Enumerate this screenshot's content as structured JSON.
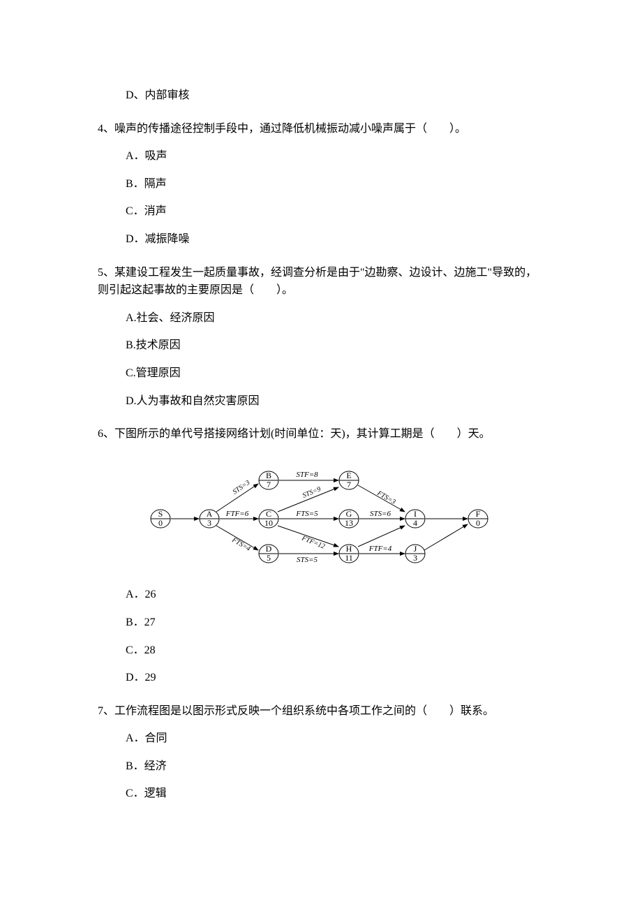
{
  "q3": {
    "options": {
      "d": "D、内部审核"
    }
  },
  "q4": {
    "text": "4、噪声的传播途径控制手段中，通过降低机械振动减小噪声属于（　　）。",
    "options": {
      "a": "A．吸声",
      "b": "B．隔声",
      "c": "C．消声",
      "d": "D．减振降噪"
    }
  },
  "q5": {
    "text_line1": "5、某建设工程发生一起质量事故，经调查分析是由于\"边勘察、边设计、边施工\"导致的，",
    "text_line2": "则引起这起事故的主要原因是（　　）。",
    "options": {
      "a": "A.社会、经济原因",
      "b": "B.技术原因",
      "c": "C.管理原因",
      "d": "D.人为事故和自然灾害原因"
    }
  },
  "q6": {
    "text": "6、下图所示的单代号搭接网络计划(时间单位：天)，其计算工期是（　　）天。",
    "options": {
      "a": "A．26",
      "b": "B．27",
      "c": "C．28",
      "d": "D．29"
    }
  },
  "q7": {
    "text": "7、工作流程图是以图示形式反映一个组织系统中各项工作之间的（　　）联系。",
    "options": {
      "a": "A．合同",
      "b": "B．经济",
      "c": "C．逻辑"
    }
  },
  "chart_data": {
    "type": "diagram",
    "description": "单代号搭接网络计划 (precedence network)",
    "time_unit": "天",
    "nodes": [
      {
        "id": "S",
        "duration": 0
      },
      {
        "id": "A",
        "duration": 3
      },
      {
        "id": "B",
        "duration": 7
      },
      {
        "id": "C",
        "duration": 10
      },
      {
        "id": "D",
        "duration": 5
      },
      {
        "id": "E",
        "duration": 7
      },
      {
        "id": "G",
        "duration": 13
      },
      {
        "id": "H",
        "duration": 11
      },
      {
        "id": "I",
        "duration": 4
      },
      {
        "id": "J",
        "duration": 3
      },
      {
        "id": "F",
        "duration": 0
      }
    ],
    "edges": [
      {
        "from": "S",
        "to": "A",
        "relation": null,
        "value": null
      },
      {
        "from": "A",
        "to": "B",
        "relation": "STS",
        "value": 3
      },
      {
        "from": "A",
        "to": "C",
        "relation": "FTF",
        "value": 6
      },
      {
        "from": "A",
        "to": "D",
        "relation": "FTS",
        "value": 4
      },
      {
        "from": "B",
        "to": "E",
        "relation": "STF",
        "value": 8
      },
      {
        "from": "C",
        "to": "E",
        "relation": "STS",
        "value": 9
      },
      {
        "from": "C",
        "to": "G",
        "relation": "FTS",
        "value": 5
      },
      {
        "from": "C",
        "to": "H",
        "relation": "FTF",
        "value": 12
      },
      {
        "from": "D",
        "to": "H",
        "relation": "STS",
        "value": 5
      },
      {
        "from": "E",
        "to": "I",
        "relation": "FTS",
        "value": 3
      },
      {
        "from": "G",
        "to": "I",
        "relation": "STS",
        "value": 6
      },
      {
        "from": "H",
        "to": "J",
        "relation": "FTF",
        "value": 4
      },
      {
        "from": "I",
        "to": "F",
        "relation": null,
        "value": null
      },
      {
        "from": "J",
        "to": "F",
        "relation": null,
        "value": null
      },
      {
        "from": "H",
        "to": "I",
        "relation": null,
        "value": null
      }
    ]
  }
}
